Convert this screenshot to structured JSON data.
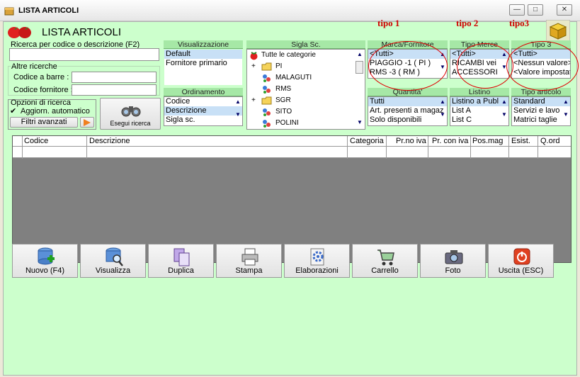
{
  "window": {
    "title": "LISTA ARTICOLI",
    "minimize": "—",
    "maximize": "□",
    "close": "✕"
  },
  "header": {
    "title": "LISTA ARTICOLI",
    "annotations": [
      "tipo 1",
      "tipo 2",
      "tipo3"
    ]
  },
  "search": {
    "main_label": "Ricerca per codice o descrizione (F2)",
    "main_value": "",
    "other_label": "Altre ricerche",
    "barcode_label": "Codice a barre :",
    "supplier_label": "Codice fornitore :"
  },
  "options": {
    "label": "Opzioni di ricerca",
    "auto_update": "Aggiorn. automatico",
    "auto_update_checked": true,
    "advanced_filters": "Filtri avanzati",
    "run_search": "Esegui ricerca"
  },
  "visualizzazione": {
    "header": "Visualizzazione",
    "items": [
      "Default",
      "Fornitore primario"
    ],
    "selected": 0
  },
  "ordinamento": {
    "header": "Ordinamento",
    "items": [
      "Codice",
      "Descrizione",
      "Sigla sc."
    ],
    "selected": 1
  },
  "sigla": {
    "header": "Sigla Sc.",
    "root": "Tutte le categorie",
    "items": [
      "PI",
      "MALAGUTI",
      "RMS",
      "SGR",
      "SITO",
      "POLINI"
    ]
  },
  "marca": {
    "header": "Marca/Fornitore",
    "items": [
      "<Tutti>",
      "PIAGGIO -1 ( PI )",
      "RMS -3 ( RM )"
    ],
    "selected": 0
  },
  "tipo_merce": {
    "header": "Tipo Merce",
    "items": [
      "<Tutti>",
      "RICAMBI vei",
      "ACCESSORI"
    ],
    "selected": 0
  },
  "tipo3": {
    "header": "Tipo 3",
    "items": [
      "<Tutti>",
      "<Nessun valore>",
      "<Valore impostato>"
    ],
    "selected": 0
  },
  "quantita": {
    "header": "Quantita'",
    "items": [
      "Tutti",
      "Art. presenti a magaz",
      "Solo disponibili"
    ],
    "selected": 0
  },
  "listino": {
    "header": "Listino",
    "items": [
      "Listino a Publ",
      "List A",
      "List C"
    ],
    "selected": 0
  },
  "tipo_articolo": {
    "header": "Tipo articolo",
    "items": [
      "Standard",
      "Servizi e lavo",
      "Matrici taglie"
    ],
    "selected": 0
  },
  "grid": {
    "columns": [
      "Codice",
      "Descrizione",
      "Categoria",
      "Pr.no iva",
      "Pr. con iva",
      "Pos.mag",
      "Esist.",
      "Q.ord"
    ]
  },
  "toolbar": {
    "buttons": [
      "Nuovo (F4)",
      "Visualizza",
      "Duplica",
      "Stampa",
      "Elaborazioni",
      "Carrello",
      "Foto",
      "Uscita (ESC)"
    ]
  },
  "colors": {
    "client_bg": "#ccffcc",
    "header_bg": "#a6e8a6",
    "selection": "#c8e0f6",
    "annotation": "#d00000",
    "grid_bg": "#808080"
  }
}
